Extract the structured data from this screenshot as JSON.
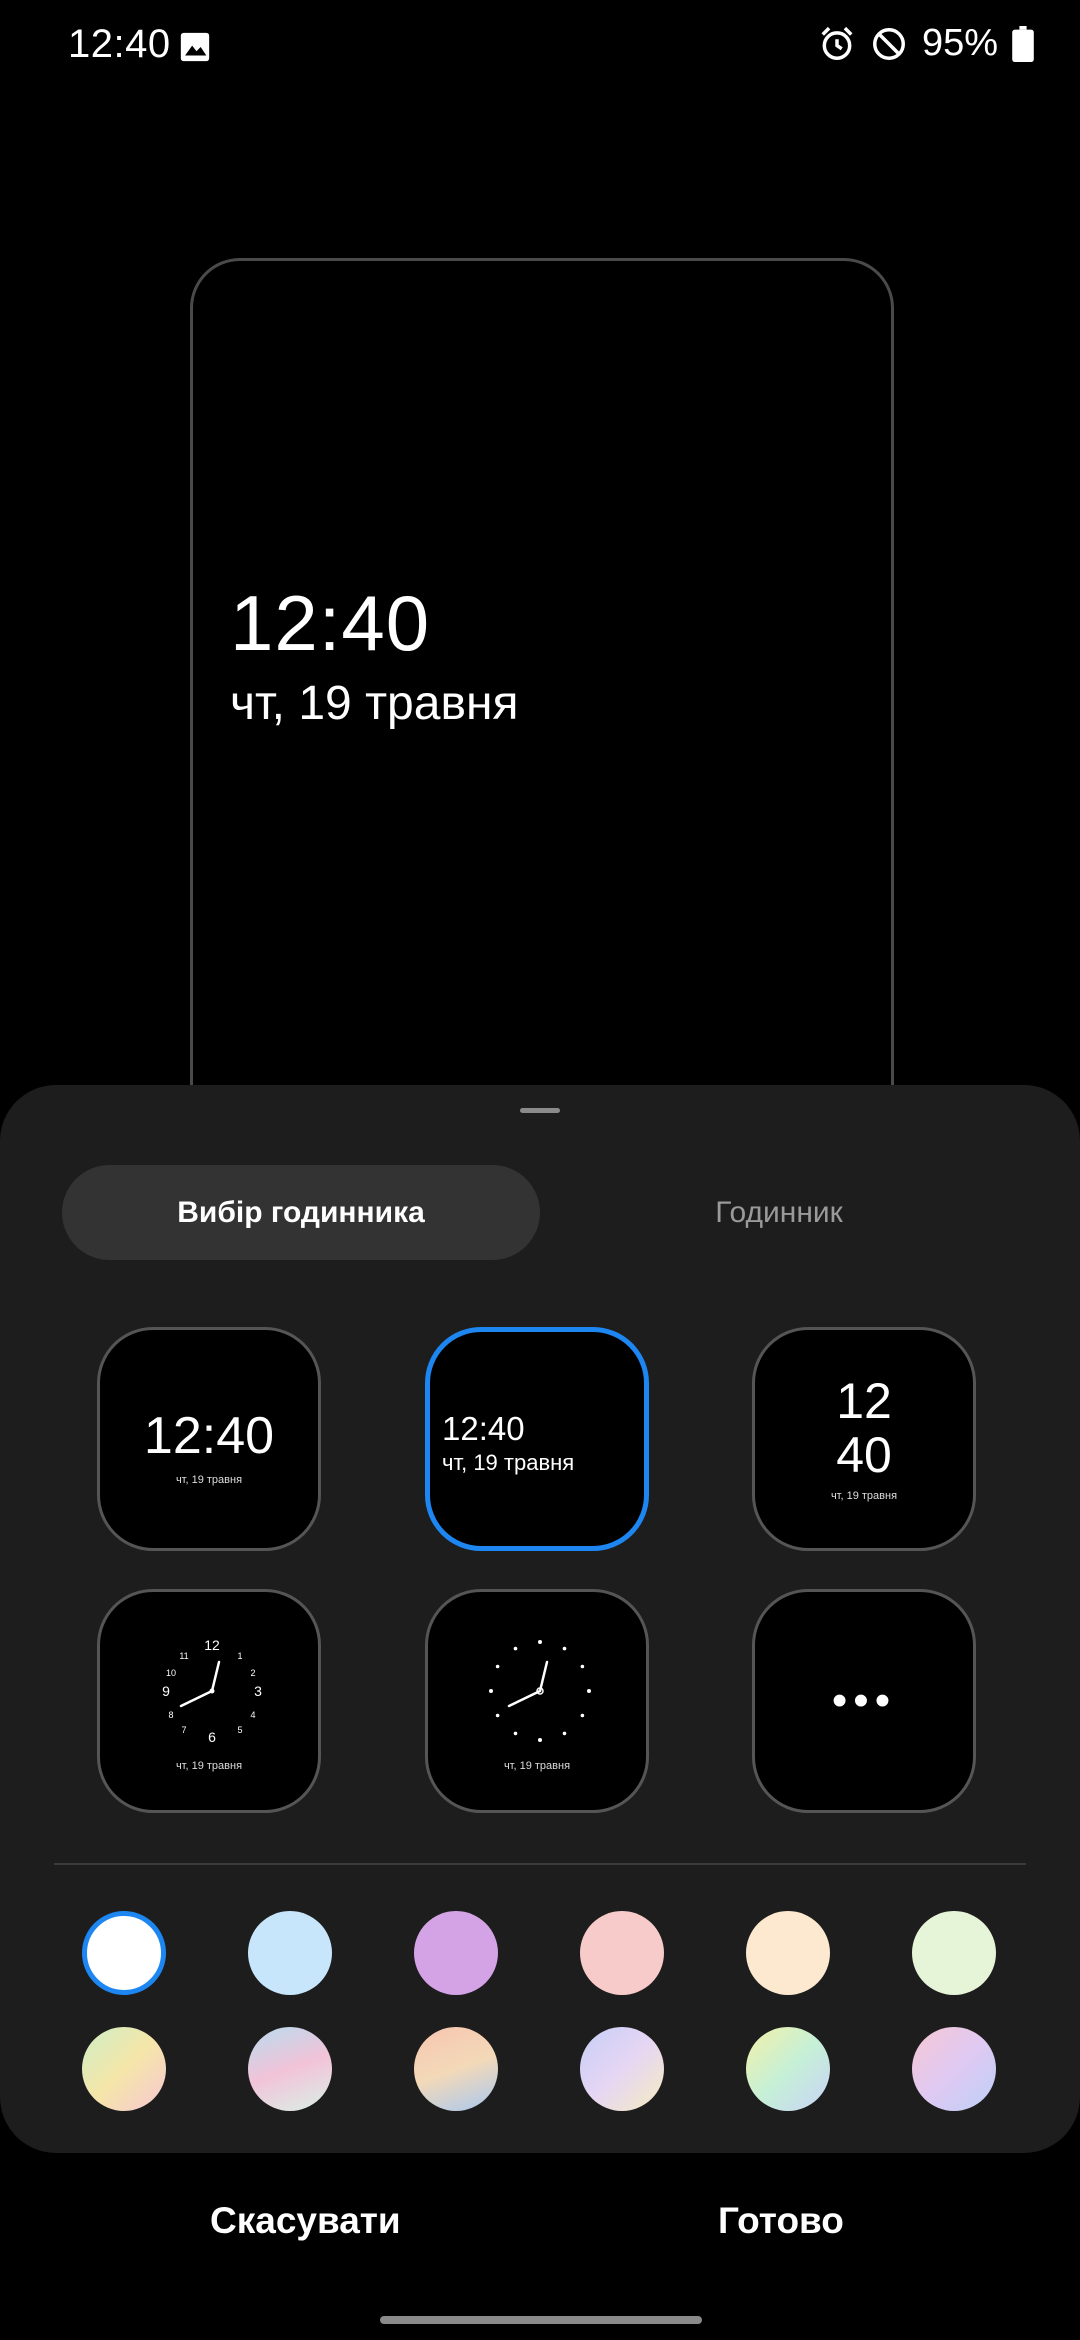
{
  "status_bar": {
    "time": "12:40",
    "battery_percent": "95%"
  },
  "preview": {
    "time": "12:40",
    "date": "чт, 19 травня"
  },
  "sheet": {
    "tabs": [
      {
        "label": "Вибір годинника",
        "selected": true
      },
      {
        "label": "Годинник",
        "selected": false
      }
    ],
    "clock_styles": [
      {
        "time": "12:40",
        "date": "чт, 19 травня"
      },
      {
        "time": "12:40",
        "date": "чт, 19 травня"
      },
      {
        "hour": "12",
        "minute": "40",
        "date": "чт, 19 травня"
      },
      {
        "numbers": [
          "12",
          "1",
          "2",
          "3",
          "4",
          "5",
          "6",
          "7",
          "8",
          "9",
          "10",
          "11"
        ],
        "date": "чт, 19 травня"
      },
      {
        "date": "чт, 19 травня"
      },
      {
        "label": "•••"
      }
    ],
    "selected_style_index": 1,
    "colors": [
      "#ffffff",
      "#c7e6fb",
      "#d4a3e6",
      "#f8cbcb",
      "#fce9cf",
      "#e6f5d8",
      "gradient-a",
      "gradient-b",
      "gradient-c",
      "gradient-d",
      "gradient-e",
      "gradient-f"
    ],
    "selected_color_index": 0
  },
  "buttons": {
    "cancel": "Скасувати",
    "done": "Готово"
  },
  "accent_color": "#1d86f0"
}
